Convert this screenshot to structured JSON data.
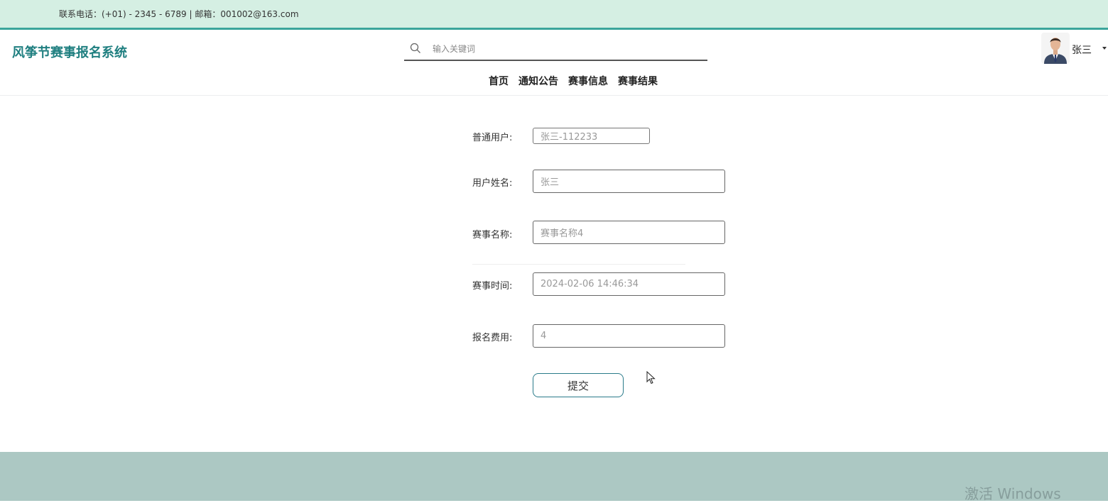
{
  "topbar": {
    "contact": "联系电话：(+01) - 2345 - 6789 | 邮箱：001002@163.com"
  },
  "header": {
    "logo": "风筝节赛事报名系统",
    "search": {
      "placeholder": "输入关键词",
      "value": ""
    },
    "nav": [
      "首页",
      "通知公告",
      "赛事信息",
      "赛事结果"
    ],
    "user": {
      "name": "张三"
    }
  },
  "form": {
    "fields": [
      {
        "label": "普通用户:",
        "value": "张三-112233"
      },
      {
        "label": "用户姓名:",
        "value": "张三"
      },
      {
        "label": "赛事名称:",
        "value": "赛事名称4"
      },
      {
        "label": "赛事时间:",
        "value": "2024-02-06 14:46:34"
      },
      {
        "label": "报名费用:",
        "value": "4"
      }
    ],
    "submit_label": "提交"
  },
  "watermark": "激活 Windows",
  "colors": {
    "topbar_bg": "#d5efe3",
    "topbar_border": "#3ba59b",
    "logo": "#1f7f80",
    "footer_bg": "#acc8c3"
  },
  "icons": {
    "search": "search-icon",
    "caret": "caret-down-icon",
    "cursor": "mouse-pointer-icon"
  }
}
